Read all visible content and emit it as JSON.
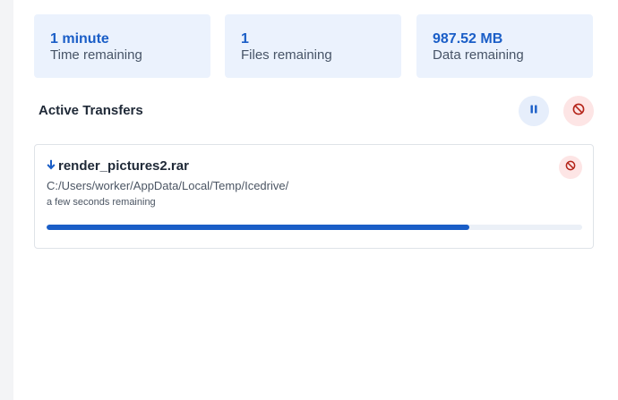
{
  "summary": {
    "time": {
      "value": "1 minute",
      "label": "Time remaining"
    },
    "files": {
      "value": "1",
      "label": "Files remaining"
    },
    "data": {
      "value": "987.52 MB",
      "label": "Data remaining"
    }
  },
  "transfers": {
    "title": "Active Transfers",
    "items": [
      {
        "name": "render_pictures2.rar",
        "path": "C:/Users/worker/AppData/Local/Temp/Icedrive/",
        "status": "a few seconds remaining",
        "direction_icon": "arrow-down-icon",
        "progress": 0.79
      }
    ]
  },
  "colors": {
    "accent": "#1a5ec7",
    "stat_bg": "#ebf2fd",
    "danger": "#b42318",
    "danger_bg": "#fde5e5"
  },
  "icons": {
    "pause": "pause-icon",
    "cancel": "block-icon",
    "download": "arrow-down-icon"
  }
}
